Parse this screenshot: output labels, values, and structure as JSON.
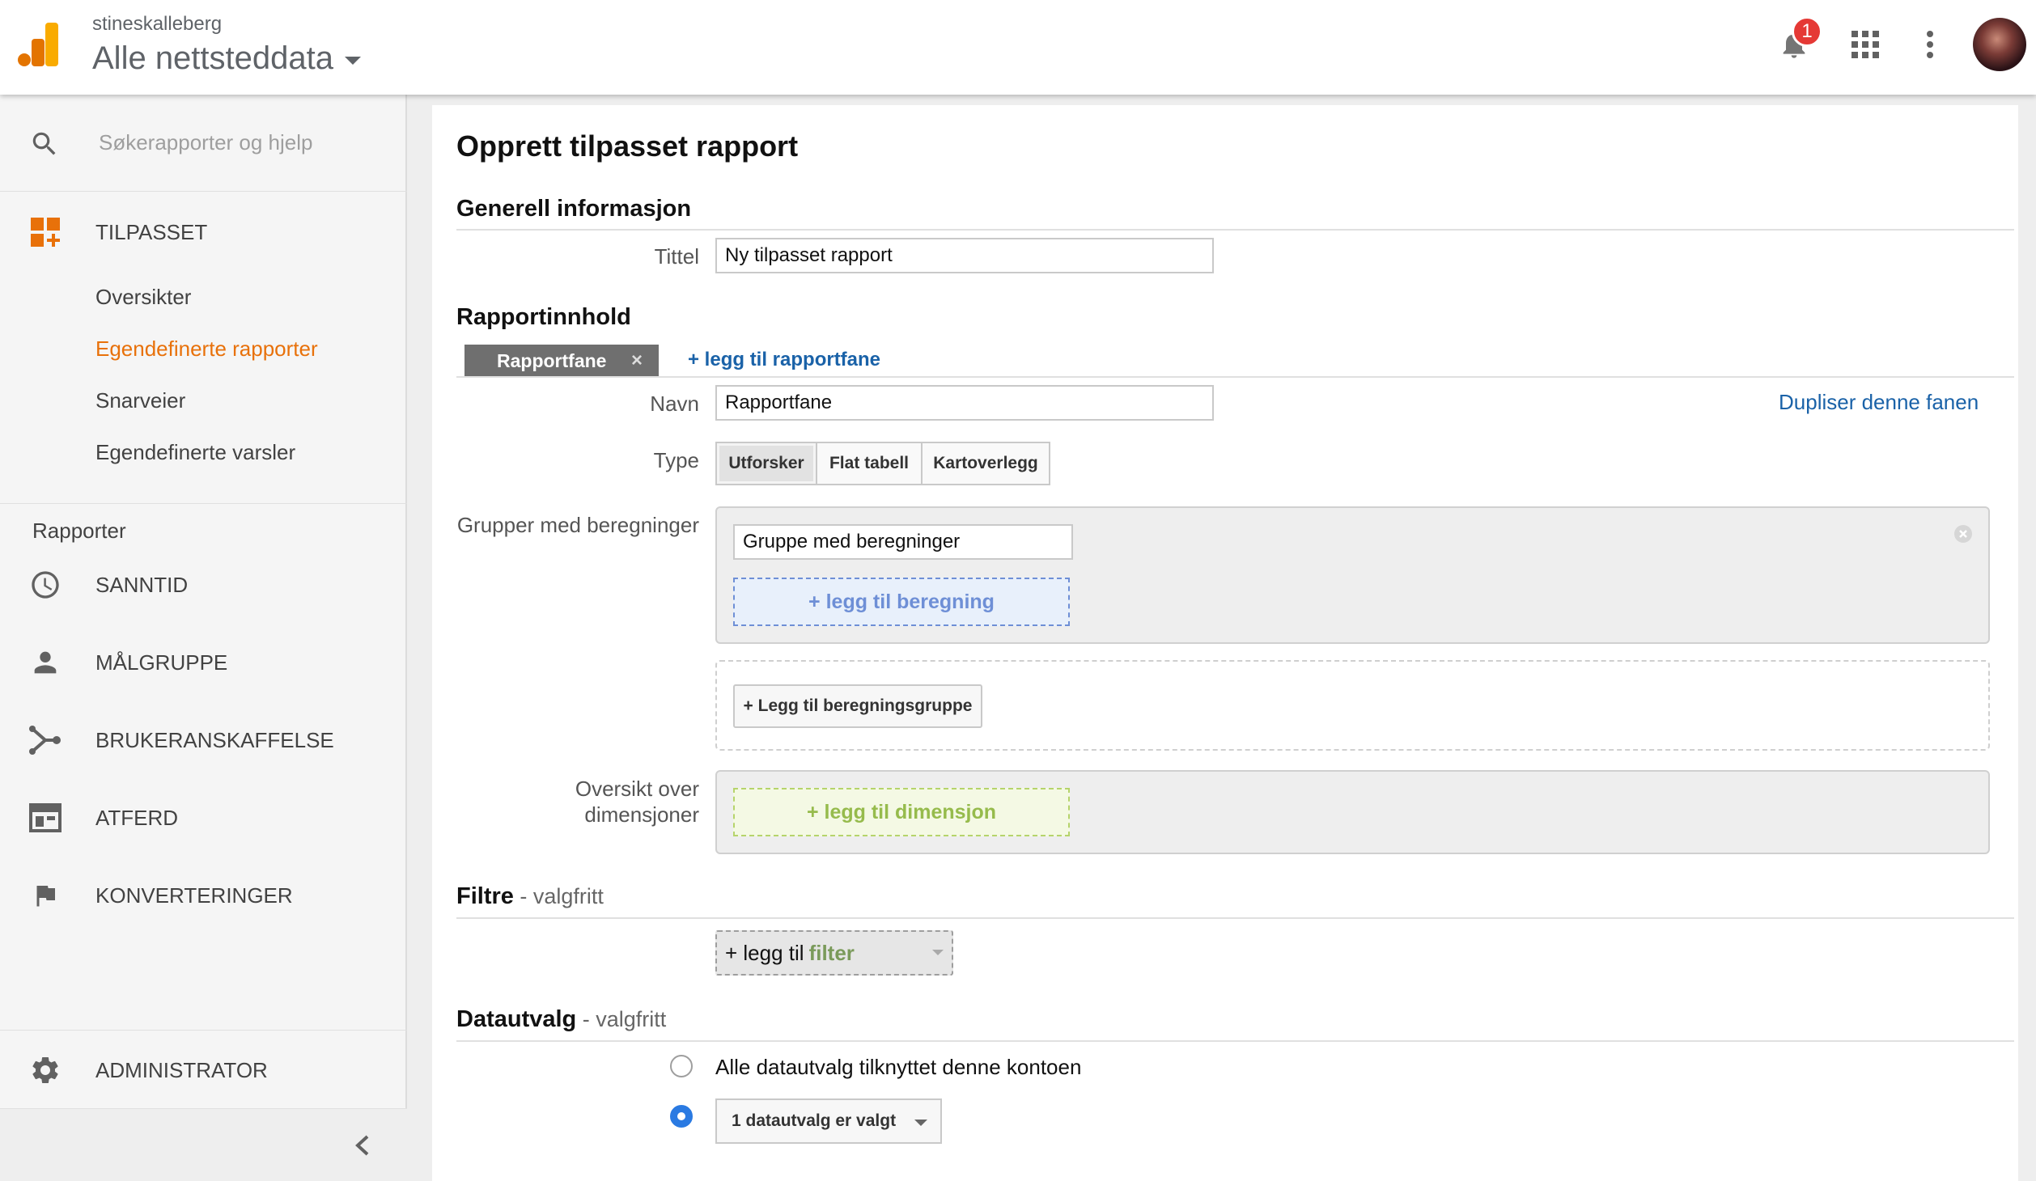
{
  "header": {
    "account": "stineskalleberg",
    "property": "Alle nettsteddata",
    "notification_count": "1",
    "icons": [
      "analytics-logo",
      "bell-icon",
      "apps-grid-icon",
      "more-vert-icon",
      "avatar"
    ]
  },
  "sidebar": {
    "search_placeholder": "Søkerapporter og hjelp",
    "custom_section": "TILPASSET",
    "custom_items": [
      {
        "label": "Oversikter",
        "active": false
      },
      {
        "label": "Egendefinerte rapporter",
        "active": true
      },
      {
        "label": "Snarveier",
        "active": false
      },
      {
        "label": "Egendefinerte varsler",
        "active": false
      }
    ],
    "reports_heading": "Rapporter",
    "reports": [
      {
        "label": "SANNTID",
        "icon": "clock-icon"
      },
      {
        "label": "MÅLGRUPPE",
        "icon": "person-icon"
      },
      {
        "label": "BRUKERANSKAFFELSE",
        "icon": "acquisition-icon"
      },
      {
        "label": "ATFERD",
        "icon": "behavior-icon"
      },
      {
        "label": "KONVERTERINGER",
        "icon": "flag-icon"
      }
    ],
    "admin": "ADMINISTRATOR"
  },
  "main": {
    "page_title": "Opprett tilpasset rapport",
    "general": {
      "heading": "Generell informasjon",
      "title_label": "Tittel",
      "title_value": "Ny tilpasset rapport"
    },
    "content": {
      "heading": "Rapportinnhold",
      "tab_label": "Rapportfane",
      "tab_close": "×",
      "add_tab": "+ legg til rapportfane",
      "name_label": "Navn",
      "name_value": "Rapportfane",
      "duplicate": "Dupliser denne fanen",
      "type_label": "Type",
      "types": [
        "Utforsker",
        "Flat tabell",
        "Kartoverlegg"
      ],
      "selected_type": "Utforsker",
      "metric_groups_label": "Grupper med beregninger",
      "metric_group_value": "Gruppe med beregninger",
      "add_metric": "+ legg til beregning",
      "add_metric_group": "+ Legg til beregningsgruppe",
      "dimension_label_1": "Oversikt over",
      "dimension_label_2": "dimensjoner",
      "add_dimension": "+ legg til dimensjon"
    },
    "filters": {
      "heading": "Filtre",
      "optional": " - valgfritt",
      "add_prefix": "+ legg til ",
      "add_keyword": "filter"
    },
    "views": {
      "heading": "Datautvalg",
      "optional": " - valgfritt",
      "option_all": "Alle datautvalg tilknyttet denne kontoen",
      "option_selected": "1 datautvalg er valgt",
      "selected_index": 1
    }
  },
  "colors": {
    "accent_orange": "#e8710a",
    "link_blue": "#1a62a8",
    "metric_blue": "#6e8fd6",
    "dimension_green": "#96bb4c"
  }
}
